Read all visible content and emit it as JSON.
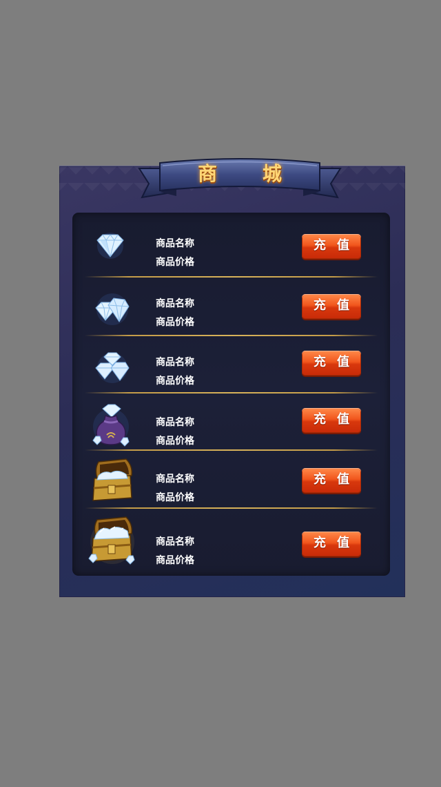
{
  "shop": {
    "title": "商 城",
    "items": [
      {
        "icon": "single-diamond-icon",
        "name": "商品名称",
        "price": "商品价格",
        "button": "充值"
      },
      {
        "icon": "two-diamonds-icon",
        "name": "商品名称",
        "price": "商品价格",
        "button": "充值"
      },
      {
        "icon": "three-diamonds-icon",
        "name": "商品名称",
        "price": "商品价格",
        "button": "充值"
      },
      {
        "icon": "diamond-bag-icon",
        "name": "商品名称",
        "price": "商品价格",
        "button": "充值"
      },
      {
        "icon": "small-treasure-chest-icon",
        "name": "商品名称",
        "price": "商品价格",
        "button": "充值"
      },
      {
        "icon": "large-treasure-chest-icon",
        "name": "商品名称",
        "price": "商品价格",
        "button": "充值"
      }
    ]
  },
  "colors": {
    "background": "#7e7e7e",
    "panel": "#2f2f5c",
    "title_gold": "#ffd676",
    "button_orange": "#f1561d",
    "separator_gold": "#c49c48"
  }
}
